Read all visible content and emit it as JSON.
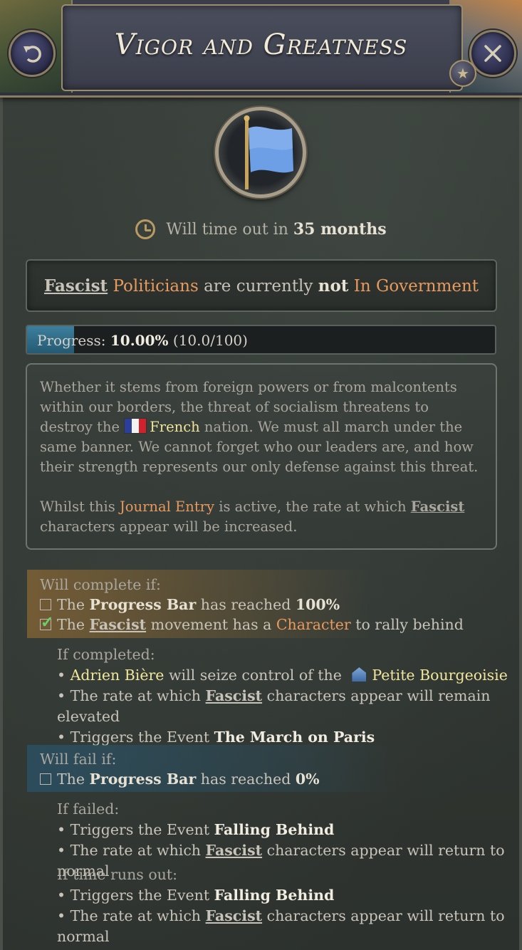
{
  "header": {
    "title": "Vigor and Greatness",
    "back_icon": "undo-arrow-icon",
    "close_icon": "close-x-icon",
    "favorite_icon": "star-icon"
  },
  "timeout": {
    "prefix": "Will time out in",
    "value": "35 months"
  },
  "status": {
    "fascist": "Fascist",
    "politicians": "Politicians",
    "mid": "are currently",
    "not": "not",
    "government": "In Government"
  },
  "progress": {
    "label": "Progress:",
    "percent": "10.00%",
    "detail": "(10.0/100)",
    "fraction": 0.1
  },
  "description": {
    "p1_a": "Whether it stems from foreign powers or from malcontents within our borders, the threat of socialism threatens to destroy the",
    "french": "French",
    "p1_b": "nation. We must all march under the same banner. We cannot forget who our leaders are, and how their strength represents our only defense against this threat.",
    "p2_a": "Whilst this",
    "journal_entry": "Journal Entry",
    "p2_b": "is active, the rate at which",
    "fascist": "Fascist",
    "p2_c": "characters appear will be increased."
  },
  "complete": {
    "heading": "Will complete if:",
    "c1_the": "The",
    "c1_bar": "Progress Bar",
    "c1_mid": "has reached",
    "c1_val": "100%",
    "c2_the": "The",
    "c2_fascist": "Fascist",
    "c2_mid": "movement has a",
    "c2_char": "Character",
    "c2_end": "to rally behind",
    "if_completed": "If completed:",
    "r1_name": "Adrien Bière",
    "r1_mid": "will seize control of the",
    "r1_group": "Petite Bourgeoisie",
    "r2_a": "The rate at which",
    "r2_fascist": "Fascist",
    "r2_b": "characters appear will remain elevated",
    "r3_a": "Triggers the Event",
    "r3_event": "The March on Paris"
  },
  "fail": {
    "heading": "Will fail if:",
    "c1_the": "The",
    "c1_bar": "Progress Bar",
    "c1_mid": "has reached",
    "c1_val": "0%",
    "if_failed": "If failed:",
    "f1_a": "Triggers the Event",
    "f1_event": "Falling Behind",
    "f2_a": "The rate at which",
    "f2_fascist": "Fascist",
    "f2_b": "characters appear will return to normal",
    "if_timeout": "If time runs out:",
    "t1_a": "Triggers the Event",
    "t1_event": "Falling Behind",
    "t2_a": "The rate at which",
    "t2_fascist": "Fascist",
    "t2_b": "characters appear will return to normal"
  }
}
